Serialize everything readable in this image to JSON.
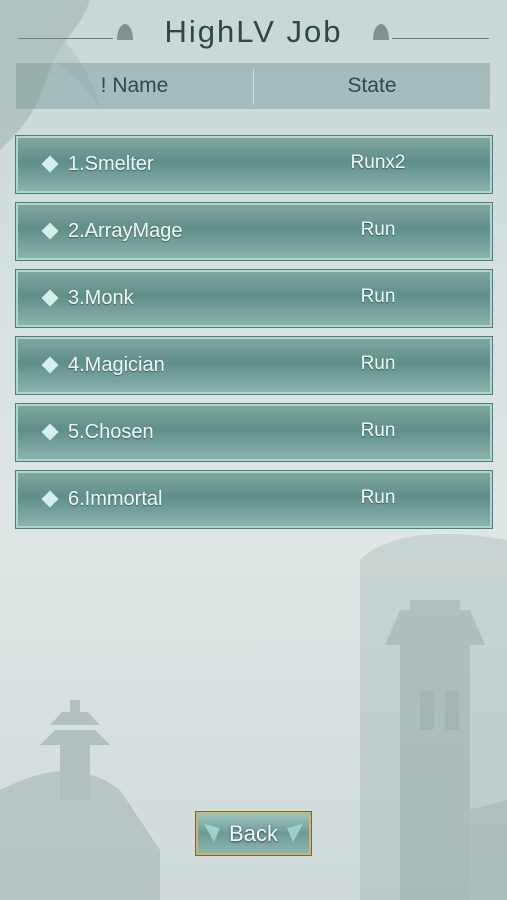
{
  "title": "HighLV Job",
  "header": {
    "name_label": "! Name",
    "state_label": "State"
  },
  "jobs": [
    {
      "name": "1.Smelter",
      "state": "Runx2"
    },
    {
      "name": "2.ArrayMage",
      "state": "Run"
    },
    {
      "name": "3.Monk",
      "state": "Run"
    },
    {
      "name": "4.Magician",
      "state": "Run"
    },
    {
      "name": "5.Chosen",
      "state": "Run"
    },
    {
      "name": "6.Immortal",
      "state": "Run"
    }
  ],
  "back_label": "Back",
  "icons": {
    "row_bullet": "diamond-icon",
    "title_ornament": "bell-ornament-icon",
    "back_decor": "gem-icon"
  },
  "colors": {
    "row_fill": "#6f9b95",
    "row_border": "#aed6d0",
    "back_border": "#c5b777",
    "title_text": "#2f4747"
  }
}
